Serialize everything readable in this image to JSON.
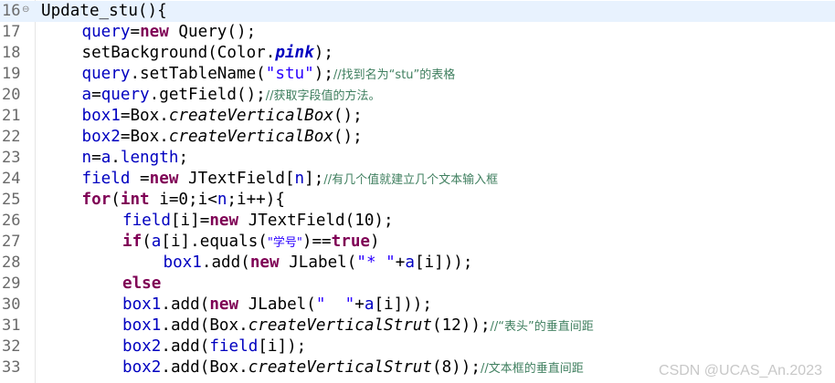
{
  "watermark": "CSDN @UCAS_An.2023",
  "lines": [
    {
      "n": "16",
      "fold": "⊖",
      "indent": 0,
      "segs": [
        {
          "t": "Update_stu(){",
          "c": ""
        }
      ]
    },
    {
      "n": "17",
      "indent": 1,
      "segs": [
        {
          "t": "query",
          "c": "fld"
        },
        {
          "t": "=",
          "c": ""
        },
        {
          "t": "new",
          "c": "kw"
        },
        {
          "t": " Query();",
          "c": ""
        }
      ]
    },
    {
      "n": "18",
      "indent": 1,
      "segs": [
        {
          "t": "setBackground(Color.",
          "c": ""
        },
        {
          "t": "pink",
          "c": "cst"
        },
        {
          "t": ");",
          "c": ""
        }
      ]
    },
    {
      "n": "19",
      "indent": 1,
      "segs": [
        {
          "t": "query",
          "c": "fld"
        },
        {
          "t": ".setTableName(",
          "c": ""
        },
        {
          "t": "\"stu\"",
          "c": "str"
        },
        {
          "t": ");",
          "c": ""
        },
        {
          "t": "//找到名为“stu”的表格",
          "c": "cmt zh"
        }
      ]
    },
    {
      "n": "20",
      "indent": 1,
      "segs": [
        {
          "t": "a",
          "c": "fld"
        },
        {
          "t": "=",
          "c": ""
        },
        {
          "t": "query",
          "c": "fld"
        },
        {
          "t": ".getField();",
          "c": ""
        },
        {
          "t": "//获取字段值的方法。",
          "c": "cmt zh"
        }
      ]
    },
    {
      "n": "21",
      "indent": 1,
      "segs": [
        {
          "t": "box1",
          "c": "fld"
        },
        {
          "t": "=Box.",
          "c": ""
        },
        {
          "t": "createVerticalBox",
          "c": "ital"
        },
        {
          "t": "();",
          "c": ""
        }
      ]
    },
    {
      "n": "22",
      "indent": 1,
      "segs": [
        {
          "t": "box2",
          "c": "fld"
        },
        {
          "t": "=Box.",
          "c": ""
        },
        {
          "t": "createVerticalBox",
          "c": "ital"
        },
        {
          "t": "();",
          "c": ""
        }
      ]
    },
    {
      "n": "23",
      "indent": 1,
      "segs": [
        {
          "t": "n",
          "c": "fld"
        },
        {
          "t": "=",
          "c": ""
        },
        {
          "t": "a",
          "c": "fld"
        },
        {
          "t": ".",
          "c": ""
        },
        {
          "t": "length",
          "c": "fld"
        },
        {
          "t": ";",
          "c": ""
        }
      ]
    },
    {
      "n": "24",
      "indent": 1,
      "segs": [
        {
          "t": "field",
          "c": "fld"
        },
        {
          "t": " =",
          "c": ""
        },
        {
          "t": "new",
          "c": "kw"
        },
        {
          "t": " JTextField[",
          "c": ""
        },
        {
          "t": "n",
          "c": "fld"
        },
        {
          "t": "];",
          "c": ""
        },
        {
          "t": "//有几个值就建立几个文本输入框",
          "c": "cmt zh"
        }
      ]
    },
    {
      "n": "25",
      "indent": 1,
      "segs": [
        {
          "t": "for",
          "c": "kw"
        },
        {
          "t": "(",
          "c": ""
        },
        {
          "t": "int",
          "c": "kw"
        },
        {
          "t": " i=0;i<",
          "c": ""
        },
        {
          "t": "n",
          "c": "fld"
        },
        {
          "t": ";i++){",
          "c": ""
        }
      ]
    },
    {
      "n": "26",
      "indent": 2,
      "segs": [
        {
          "t": "field",
          "c": "fld"
        },
        {
          "t": "[i]=",
          "c": ""
        },
        {
          "t": "new",
          "c": "kw"
        },
        {
          "t": " JTextField(10);",
          "c": ""
        }
      ]
    },
    {
      "n": "27",
      "indent": 2,
      "segs": [
        {
          "t": "if",
          "c": "kw"
        },
        {
          "t": "(",
          "c": ""
        },
        {
          "t": "a",
          "c": "fld"
        },
        {
          "t": "[i].equals(",
          "c": ""
        },
        {
          "t": "\"学号\"",
          "c": "str zh"
        },
        {
          "t": ")==",
          "c": ""
        },
        {
          "t": "true",
          "c": "kw"
        },
        {
          "t": ")",
          "c": ""
        }
      ]
    },
    {
      "n": "28",
      "indent": 3,
      "segs": [
        {
          "t": "box1",
          "c": "fld"
        },
        {
          "t": ".add(",
          "c": ""
        },
        {
          "t": "new",
          "c": "kw"
        },
        {
          "t": " JLabel(",
          "c": ""
        },
        {
          "t": "\"* \"",
          "c": "str"
        },
        {
          "t": "+",
          "c": ""
        },
        {
          "t": "a",
          "c": "fld"
        },
        {
          "t": "[i]));",
          "c": ""
        }
      ]
    },
    {
      "n": "29",
      "indent": 2,
      "segs": [
        {
          "t": "else",
          "c": "kw"
        }
      ]
    },
    {
      "n": "30",
      "indent": 2,
      "segs": [
        {
          "t": "box1",
          "c": "fld"
        },
        {
          "t": ".add(",
          "c": ""
        },
        {
          "t": "new",
          "c": "kw"
        },
        {
          "t": " JLabel(",
          "c": ""
        },
        {
          "t": "\"  \"",
          "c": "str"
        },
        {
          "t": "+",
          "c": ""
        },
        {
          "t": "a",
          "c": "fld"
        },
        {
          "t": "[i]));",
          "c": ""
        }
      ]
    },
    {
      "n": "31",
      "indent": 2,
      "segs": [
        {
          "t": "box1",
          "c": "fld"
        },
        {
          "t": ".add(Box.",
          "c": ""
        },
        {
          "t": "createVerticalStrut",
          "c": "ital"
        },
        {
          "t": "(12));",
          "c": ""
        },
        {
          "t": "//“表头”的垂直间距",
          "c": "cmt zh"
        }
      ]
    },
    {
      "n": "32",
      "indent": 2,
      "segs": [
        {
          "t": "box2",
          "c": "fld"
        },
        {
          "t": ".add(",
          "c": ""
        },
        {
          "t": "field",
          "c": "fld"
        },
        {
          "t": "[i]);",
          "c": ""
        }
      ]
    },
    {
      "n": "33",
      "indent": 2,
      "segs": [
        {
          "t": "box2",
          "c": "fld"
        },
        {
          "t": ".add(Box.",
          "c": ""
        },
        {
          "t": "createVerticalStrut",
          "c": "ital"
        },
        {
          "t": "(8));",
          "c": ""
        },
        {
          "t": "//文本框的垂直间距",
          "c": "cmt zh"
        }
      ]
    }
  ]
}
